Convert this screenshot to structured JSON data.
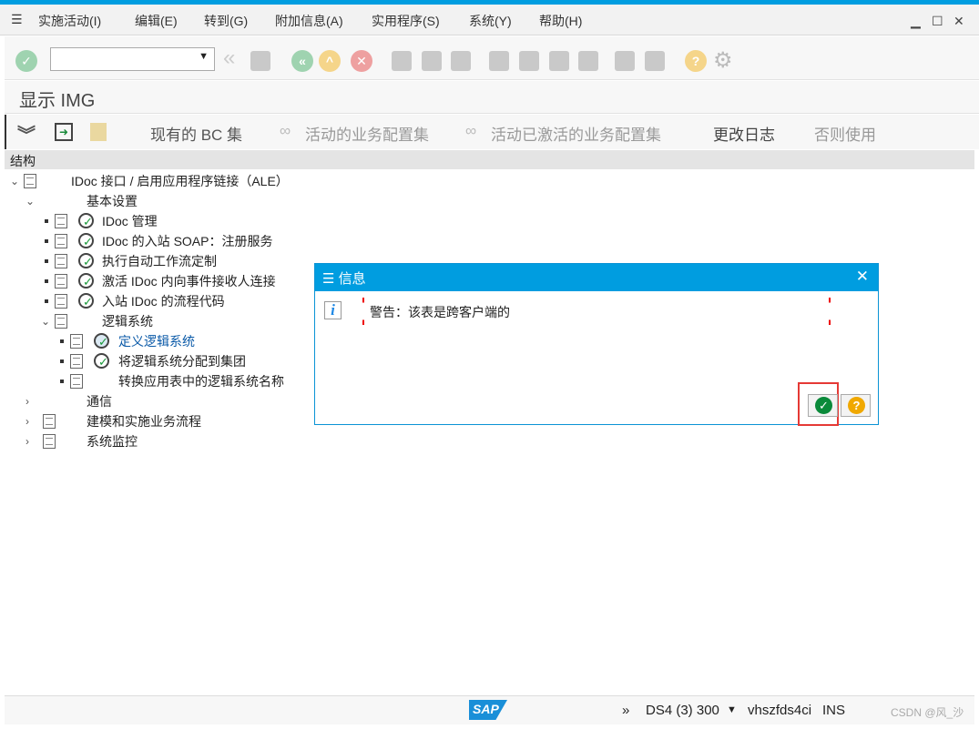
{
  "menu": {
    "items": [
      "实施活动(I)",
      "编辑(E)",
      "转到(G)",
      "附加信息(A)",
      "实用程序(S)",
      "系统(Y)",
      "帮助(H)"
    ],
    "window_buttons": [
      "▁",
      "☐",
      "✕"
    ]
  },
  "toolbar": {
    "command_value": ""
  },
  "page_title": "显示 IMG",
  "app_toolbar": {
    "items": [
      "现有的 BC 集",
      "活动的业务配置集",
      "活动已激活的业务配置集",
      "更改日志",
      "否则使用"
    ]
  },
  "structure_header": "结构",
  "tree": [
    {
      "label": "IDoc 接口 / 启用应用程序链接（ALE）",
      "expander": "⌄",
      "doc": true,
      "clock": false,
      "level": 0
    },
    {
      "label": "基本设置",
      "expander": "⌄",
      "doc": false,
      "clock": false,
      "level": 1
    },
    {
      "label": "IDoc 管理",
      "expander": "",
      "doc": true,
      "clock": true,
      "level": 2
    },
    {
      "label": "IDoc 的入站 SOAP：注册服务",
      "expander": "",
      "doc": true,
      "clock": true,
      "level": 2
    },
    {
      "label": "执行自动工作流定制",
      "expander": "",
      "doc": true,
      "clock": true,
      "level": 2
    },
    {
      "label": "激活 IDoc 内向事件接收人连接",
      "expander": "",
      "doc": true,
      "clock": true,
      "level": 2
    },
    {
      "label": "入站 IDoc 的流程代码",
      "expander": "",
      "doc": true,
      "clock": true,
      "level": 2
    },
    {
      "label": "逻辑系统",
      "expander": "⌄",
      "doc": true,
      "clock": false,
      "level": 2
    },
    {
      "label": "定义逻辑系统",
      "expander": "",
      "doc": true,
      "clock": true,
      "level": 3,
      "selected": true
    },
    {
      "label": "将逻辑系统分配到集团",
      "expander": "",
      "doc": true,
      "clock": true,
      "level": 3
    },
    {
      "label": "转换应用表中的逻辑系统名称",
      "expander": "",
      "doc": true,
      "clock": false,
      "level": 3
    },
    {
      "label": "通信",
      "expander": "›",
      "doc": false,
      "clock": false,
      "level": 1
    },
    {
      "label": "建模和实施业务流程",
      "expander": "›",
      "doc": true,
      "clock": false,
      "level": 1
    },
    {
      "label": "系统监控",
      "expander": "›",
      "doc": true,
      "clock": false,
      "level": 1
    }
  ],
  "dialog": {
    "title": "信息",
    "message": "警告：该表是跨客户端的",
    "close": "✕",
    "ok_icon": "check-icon",
    "help_icon": "question-icon"
  },
  "status": {
    "more": "»",
    "system": "DS4 (3) 300",
    "server": "vhszfds4ci",
    "mode": "INS",
    "watermark": "CSDN @风_沙"
  },
  "colors": {
    "accent": "#009de0",
    "highlight": "#e53935"
  }
}
